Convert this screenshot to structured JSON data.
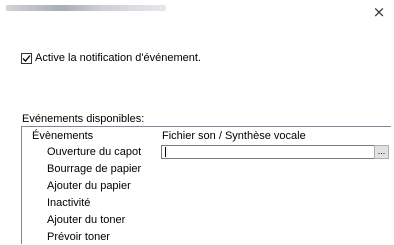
{
  "window": {
    "close_glyph": "×"
  },
  "notification": {
    "label": "Active la notification d'événement.",
    "checked": true
  },
  "events_section": {
    "label": "Evénements disponibles:",
    "columns": {
      "events": "Évènements",
      "sound": "Fichier son / Synthèse vocale"
    },
    "items": [
      {
        "label": "Ouverture du capot"
      },
      {
        "label": "Bourrage de papier"
      },
      {
        "label": "Ajouter du papier"
      },
      {
        "label": "Inactivité"
      },
      {
        "label": "Ajouter du toner"
      },
      {
        "label": "Prévoir toner"
      }
    ],
    "sound_field_value": "",
    "browse_label": "..."
  }
}
